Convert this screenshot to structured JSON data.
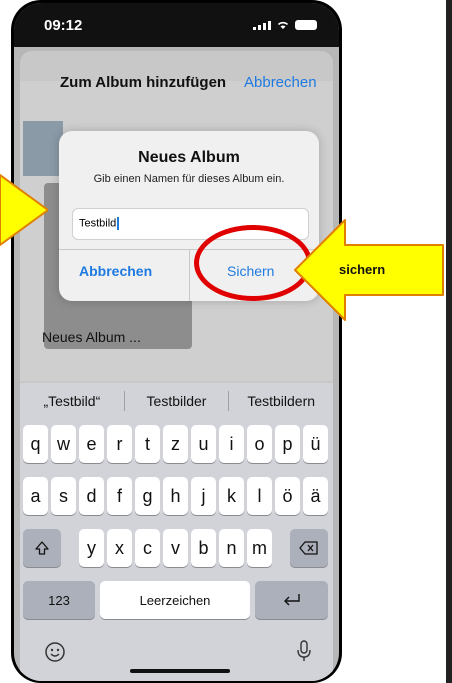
{
  "status": {
    "time": "09:12"
  },
  "sheet": {
    "title": "Zum Album hinzufügen",
    "cancel": "Abbrechen",
    "album_label": "Neues Album ..."
  },
  "dialog": {
    "title": "Neues Album",
    "subtitle": "Gib einen Namen für dieses Album ein.",
    "input_value": "Testbild",
    "cancel_button": "Abbrechen",
    "save_button": "Sichern"
  },
  "callout": {
    "label": "sichern"
  },
  "keyboard": {
    "suggestions": [
      "„Testbild“",
      "Testbilder",
      "Testbildern"
    ],
    "row1": [
      "q",
      "w",
      "e",
      "r",
      "t",
      "z",
      "u",
      "i",
      "o",
      "p",
      "ü"
    ],
    "row2": [
      "a",
      "s",
      "d",
      "f",
      "g",
      "h",
      "j",
      "k",
      "l",
      "ö",
      "ä"
    ],
    "row3": [
      "y",
      "x",
      "c",
      "v",
      "b",
      "n",
      "m"
    ],
    "numbers_key": "123",
    "space_key": "Leerzeichen"
  },
  "colors": {
    "accent": "#1f7ae0",
    "highlight": "#e00000",
    "arrow_fill": "#ffff00"
  }
}
